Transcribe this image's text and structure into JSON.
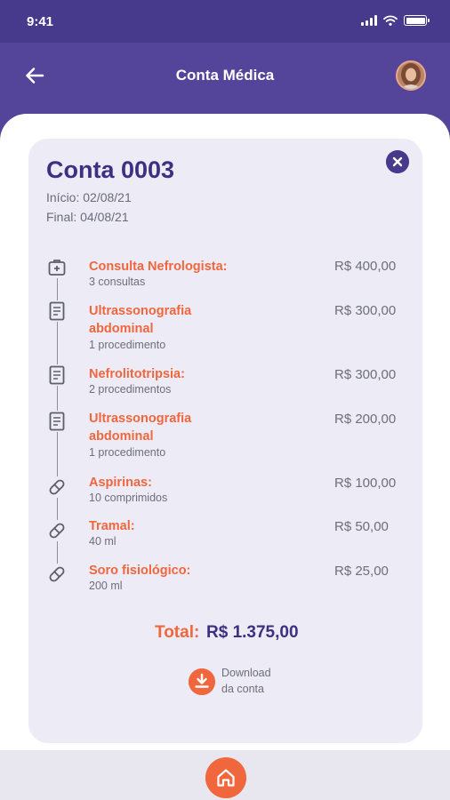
{
  "status_bar": {
    "time": "9:41"
  },
  "header": {
    "title": "Conta Médica"
  },
  "bill": {
    "title": "Conta 0003",
    "start_date": "Início: 02/08/21",
    "end_date": "Final: 04/08/21",
    "items": [
      {
        "icon": "medical-kit-icon",
        "name_lines": [
          "Consulta Nefrologista:"
        ],
        "qty": "3 consultas",
        "price": "R$ 400,00"
      },
      {
        "icon": "document-icon",
        "name_lines": [
          "Ultrassonografia",
          "abdominal"
        ],
        "qty": "1 procedimento",
        "price": "R$ 300,00"
      },
      {
        "icon": "document-icon",
        "name_lines": [
          "Nefrolitotripsia:"
        ],
        "qty": "2 procedimentos",
        "price": "R$ 300,00"
      },
      {
        "icon": "document-icon",
        "name_lines": [
          "Ultrassonografia",
          "abdominal"
        ],
        "qty": "1 procedimento",
        "price": "R$ 200,00"
      },
      {
        "icon": "pill-icon",
        "name_lines": [
          "Aspirinas:"
        ],
        "qty": "10 comprimidos",
        "price": "R$ 100,00"
      },
      {
        "icon": "pill-icon",
        "name_lines": [
          "Tramal:"
        ],
        "qty": "40 ml",
        "price": "R$ 50,00"
      },
      {
        "icon": "pill-icon",
        "name_lines": [
          "Soro fisiológico:"
        ],
        "qty": "200 ml",
        "price": "R$ 25,00"
      }
    ],
    "total_label": "Total:",
    "total_value": "R$ 1.375,00",
    "download_line1": "Download",
    "download_line2": "da conta"
  },
  "colors": {
    "header": "#54449a",
    "status_bar": "#473a8c",
    "accent": "#f0663d",
    "title": "#3d2f82",
    "card": "#ecebf6"
  }
}
